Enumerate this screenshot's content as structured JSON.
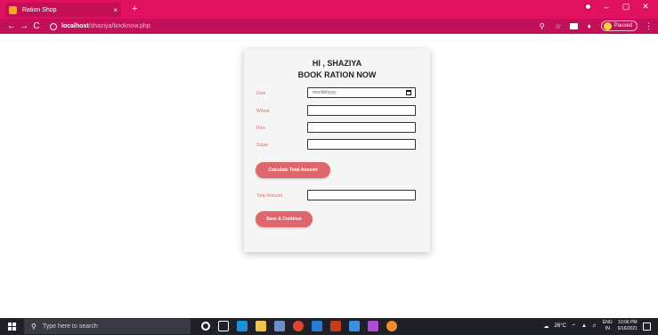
{
  "browser": {
    "tab_title": "Ration Shop",
    "tab_close": "×",
    "new_tab": "+",
    "window": {
      "minimize": "–",
      "maximize": "▢",
      "close": "✕"
    },
    "nav": {
      "back": "←",
      "forward": "→",
      "reload": "C"
    },
    "url_host": "localhost",
    "url_path": "/shaziya/booknow.php",
    "profile_label": "Paused"
  },
  "page": {
    "greeting": "HI , SHAZIYA",
    "heading": "BOOK RATION NOW",
    "fields": {
      "date": {
        "label": "Date",
        "placeholder": "mm/dd/yyyy"
      },
      "wheat": {
        "label": "Wheat"
      },
      "rice": {
        "label": "Rice"
      },
      "sugar": {
        "label": "Sugar"
      },
      "total": {
        "label": "Total Amount"
      }
    },
    "calculate_button": "Calculate Total Amount",
    "save_button": "Save & Continue"
  },
  "taskbar": {
    "search_placeholder": "Type here to search",
    "weather": "26°C",
    "lang_top": "ENG",
    "lang_bottom": "IN",
    "time": "10:06 PM",
    "date": "6/16/2021"
  },
  "colors": {
    "browser_frame": "#e0115f",
    "button": "#e0666d",
    "label": "#d97070"
  }
}
